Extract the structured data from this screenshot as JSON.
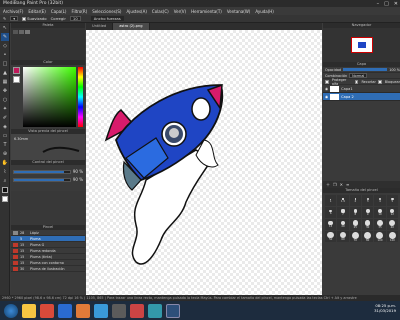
{
  "window": {
    "title": "MediBang Paint Pro (32bit)",
    "controls": [
      "–",
      "□",
      "✕"
    ]
  },
  "menu": [
    "Archivo(F)",
    "Editar(E)",
    "Capa(L)",
    "Filtro(R)",
    "Selecciones(S)",
    "Ajustes(A)",
    "Colas(C)",
    "Ver(V)",
    "Herramienta(T)",
    "Ventana(W)",
    "Ayuda(H)"
  ],
  "options": {
    "suavizado_label": "Suavizado",
    "corregir_label": "Corregir",
    "corregir_value": "10",
    "ancho_label": "Ancho fuerzas"
  },
  "tabs": [
    {
      "label": "Untitled"
    },
    {
      "label": "astro (2).png"
    }
  ],
  "panels": {
    "paleta": "Paleta",
    "color": "Color",
    "brush_size": "Vista previa del pincel",
    "brush_value": "6.30mm",
    "control": "Control del pincel",
    "percent1": "90 %",
    "percent2": "90 %",
    "pinceles": "Pincel",
    "navigator": "Navegador",
    "capa": "Capa",
    "tamano": "Tamaño del pincel"
  },
  "brushes": [
    {
      "size": "28",
      "name": "Lápiz",
      "color": "#888888"
    },
    {
      "size": "5",
      "name": "Pluma",
      "color": "#2f6db5",
      "selected": true
    },
    {
      "size": "15",
      "name": "Pluma G",
      "color": "#c0392b"
    },
    {
      "size": "15",
      "name": "Pluma redonda",
      "color": "#c0392b"
    },
    {
      "size": "15",
      "name": "Pluma (tinta)",
      "color": "#c0392b"
    },
    {
      "size": "15",
      "name": "Pluma con contorno",
      "color": "#c0392b"
    },
    {
      "size": "30",
      "name": "Pluma de ilustración",
      "color": "#c0392b"
    }
  ],
  "layer_panel": {
    "opacidad_label": "Opacidad",
    "opacidad_value": "100 %",
    "mezcla_label": "Combinación",
    "mezcla_value": "Normal",
    "proteger_label": "Proteger alfa",
    "recortar_label": "Recortar",
    "bloquear_label": "Bloquear"
  },
  "layers": [
    {
      "name": "Capa1",
      "selected": false
    },
    {
      "name": "Capa 2",
      "selected": true
    }
  ],
  "brush_sizes": [
    "1",
    "1.5",
    "2",
    "3",
    "4",
    "5",
    "6",
    "7",
    "8",
    "9",
    "10",
    "12",
    "15",
    "20",
    "25",
    "30",
    "35",
    "40",
    "50",
    "60",
    "70",
    "80",
    "100",
    "120"
  ],
  "status": "2960 * 2960 pixel  (98.6 x 98.6 cm)  72 dpi  16 %  ( 1105, 865 )  Para trazar una línea recta, mantenga pulsada la tecla Mayús. Para cambiar el tamaño del pincel, mantenga pulsada las teclas Ctrl + Alt y arrastre",
  "clock": {
    "time": "08:25 p.m.",
    "date": "31/03/2019"
  },
  "colors": {
    "accent": "#2f6db5",
    "rocket_blue": "#1f45c4",
    "rocket_pink": "#d81b6b",
    "taskbar": "#1d2c3e"
  }
}
